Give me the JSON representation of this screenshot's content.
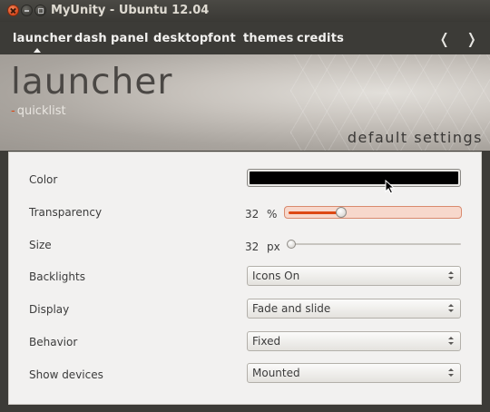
{
  "window": {
    "title": "MyUnity - Ubuntu 12.04"
  },
  "nav": {
    "items": [
      "launcher",
      "dash",
      "panel",
      "desktop",
      "font",
      "themes",
      "credits"
    ],
    "prev_arrow": "❬",
    "next_arrow": "❭"
  },
  "header": {
    "title": "launcher",
    "subtitle": "quicklist",
    "subtitle_dash": "-",
    "defaults_link": "default settings"
  },
  "settings": {
    "color": {
      "label": "Color",
      "value": "#000000"
    },
    "transparency": {
      "label": "Transparency",
      "value": "32",
      "unit": "%",
      "percent": 32
    },
    "size": {
      "label": "Size",
      "value": "32",
      "unit": "px",
      "percent": 0
    },
    "backlights": {
      "label": "Backlights",
      "value": "Icons On"
    },
    "display": {
      "label": "Display",
      "value": "Fade and slide"
    },
    "behavior": {
      "label": "Behavior",
      "value": "Fixed"
    },
    "show_devices": {
      "label": "Show devices",
      "value": "Mounted"
    }
  },
  "colors": {
    "accent": "#dd4814",
    "window_bg": "#3c3b37",
    "panel_bg": "#f2f1f0"
  }
}
